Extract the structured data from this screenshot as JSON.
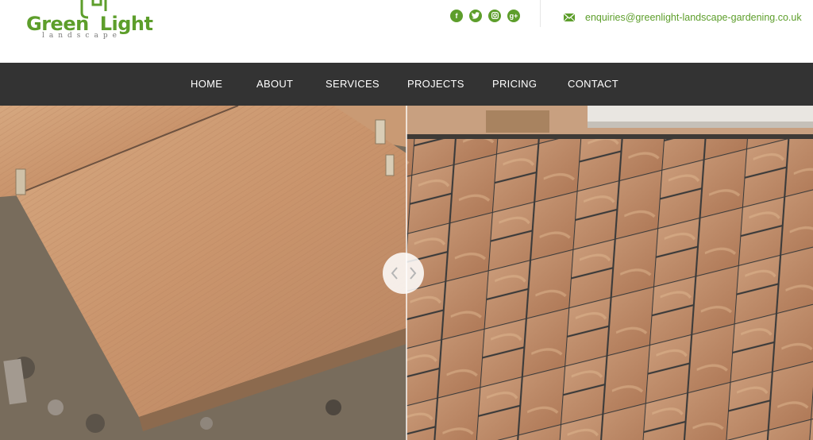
{
  "brand": {
    "name_part1": "Green",
    "name_part2": "Light",
    "tagline": "landscape",
    "color": "#5d9e2b"
  },
  "social": {
    "items": [
      {
        "name": "facebook-icon",
        "glyph": "f"
      },
      {
        "name": "twitter-icon",
        "glyph": ""
      },
      {
        "name": "instagram-icon",
        "glyph": ""
      },
      {
        "name": "google-plus-icon",
        "glyph": "g+"
      }
    ]
  },
  "contact": {
    "email": "enquiries@greenlight-landscape-gardening.co.uk",
    "email_icon": "envelope-icon"
  },
  "nav": {
    "items": [
      "HOME",
      "ABOUT",
      "SERVICES",
      "PROJECTS",
      "PRICING",
      "CONTACT"
    ],
    "background": "#333333"
  },
  "slider": {
    "type": "before-after-comparison",
    "handle_icon_left": "chevron-left-icon",
    "handle_icon_right": "chevron-right-icon"
  }
}
